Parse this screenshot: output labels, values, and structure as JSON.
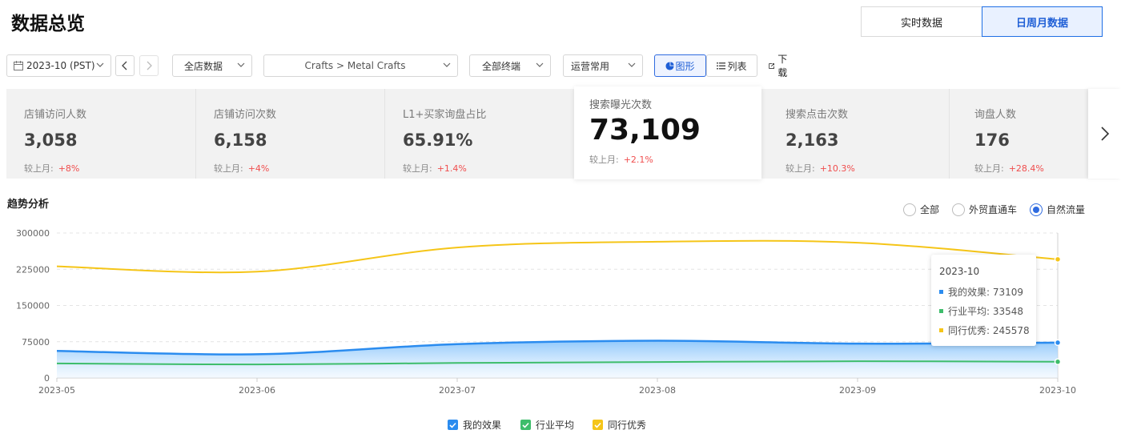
{
  "page": {
    "title": "数据总览"
  },
  "period_toggle": {
    "options": [
      "实时数据",
      "日周月数据"
    ],
    "selected": "日周月数据"
  },
  "toolbar": {
    "date": "2023-10 (PST)",
    "store": "全店数据",
    "category": "Crafts > Metal Crafts",
    "terminal": "全部终端",
    "ops": "运营常用",
    "view_chart": "图形",
    "view_list": "列表",
    "download": "下载"
  },
  "metrics": [
    {
      "label": "店铺访问人数",
      "value": "3,058",
      "comp_label": "较上月:",
      "delta": "+8%"
    },
    {
      "label": "店铺访问次数",
      "value": "6,158",
      "comp_label": "较上月:",
      "delta": "+4%"
    },
    {
      "label": "L1+买家询盘占比",
      "value": "65.91%",
      "comp_label": "较上月:",
      "delta": "+1.4%"
    },
    {
      "label": "搜索曝光次数",
      "value": "73,109",
      "comp_label": "较上月:",
      "delta": "+2.1%",
      "active": true
    },
    {
      "label": "搜索点击次数",
      "value": "2,163",
      "comp_label": "较上月:",
      "delta": "+10.3%"
    },
    {
      "label": "询盘人数",
      "value": "176",
      "comp_label": "较上月:",
      "delta": "+28.4%"
    }
  ],
  "trend": {
    "title": "趋势分析",
    "filters": [
      "全部",
      "外贸直通车",
      "自然流量"
    ],
    "selected_filter": "自然流量"
  },
  "colors": {
    "accent": "#2f6be0",
    "mine": "#2b8cef",
    "industry": "#3ebd6b",
    "peers": "#f5c518",
    "up": "#f04e4e"
  },
  "chart_data": {
    "type": "line",
    "x": [
      "2023-05",
      "2023-06",
      "2023-07",
      "2023-08",
      "2023-09",
      "2023-10"
    ],
    "ylim": [
      0,
      300000
    ],
    "yticks": [
      0,
      75000,
      150000,
      225000,
      300000
    ],
    "grid": true,
    "legend_position": "bottom",
    "series": [
      {
        "name": "我的效果",
        "values": [
          56000,
          49000,
          70000,
          77000,
          71000,
          73109
        ],
        "color": "#2b8cef",
        "area": true
      },
      {
        "name": "行业平均",
        "values": [
          30000,
          28000,
          31000,
          33000,
          34500,
          33548
        ],
        "color": "#3ebd6b"
      },
      {
        "name": "同行优秀",
        "values": [
          231000,
          220000,
          270000,
          282000,
          280000,
          245578
        ],
        "color": "#f5c518"
      }
    ],
    "tooltip": {
      "title": "2023-10",
      "rows": [
        {
          "name": "我的效果",
          "value": "73109"
        },
        {
          "name": "行业平均",
          "value": "33548"
        },
        {
          "name": "同行优秀",
          "value": "245578"
        }
      ]
    }
  }
}
